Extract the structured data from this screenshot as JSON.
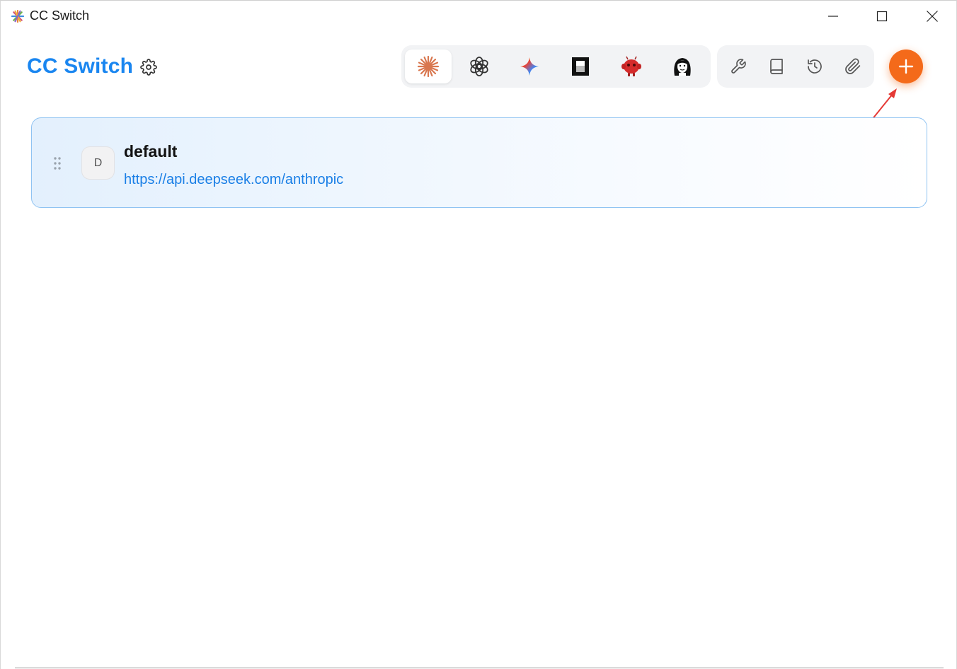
{
  "window": {
    "title": "CC Switch",
    "controls": [
      "minimize-icon",
      "maximize-icon",
      "close-icon"
    ]
  },
  "header": {
    "brand": "CC Switch",
    "settings_icon": "gear-icon",
    "apps": [
      {
        "name": "claude",
        "icon": "claude-starburst-icon",
        "active": true
      },
      {
        "name": "openai",
        "icon": "openai-knot-icon",
        "active": false
      },
      {
        "name": "gemini",
        "icon": "gemini-sparkle-icon",
        "active": false
      },
      {
        "name": "opencode",
        "icon": "dark-square-icon",
        "active": false
      },
      {
        "name": "red-robot",
        "icon": "red-robot-icon",
        "active": false
      },
      {
        "name": "avatar-app",
        "icon": "bw-face-icon",
        "active": false
      }
    ],
    "tools": [
      "wrench-icon",
      "book-icon",
      "history-icon",
      "paperclip-icon"
    ],
    "add_icon": "plus-icon"
  },
  "providers": [
    {
      "initial": "D",
      "name": "default",
      "url": "https://api.deepseek.com/anthropic",
      "active": true
    }
  ],
  "colors": {
    "brand": "#1a86f0",
    "accent": "#f46a1a",
    "link": "#1a7fe6",
    "card_border": "#8fc3f2",
    "annotation": "#e53935"
  }
}
